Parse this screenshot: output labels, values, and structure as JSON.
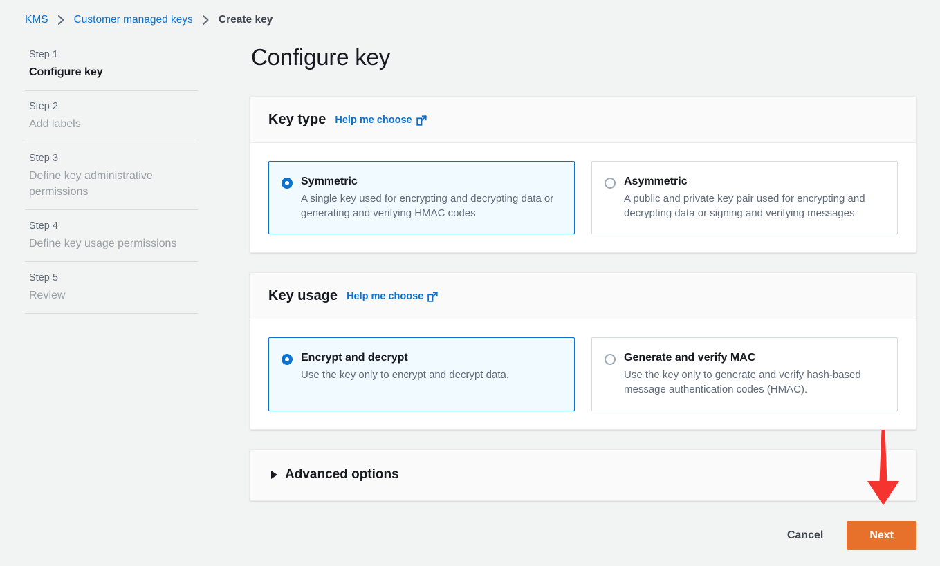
{
  "breadcrumb": {
    "items": [
      {
        "label": "KMS",
        "current": false
      },
      {
        "label": "Customer managed keys",
        "current": false
      },
      {
        "label": "Create key",
        "current": true
      }
    ]
  },
  "sidebar": {
    "steps": [
      {
        "number": "Step 1",
        "label": "Configure key",
        "active": true
      },
      {
        "number": "Step 2",
        "label": "Add labels",
        "active": false
      },
      {
        "number": "Step 3",
        "label": "Define key administrative permissions",
        "active": false
      },
      {
        "number": "Step 4",
        "label": "Define key usage permissions",
        "active": false
      },
      {
        "number": "Step 5",
        "label": "Review",
        "active": false
      }
    ]
  },
  "main": {
    "page_title": "Configure key",
    "key_type_panel": {
      "title": "Key type",
      "help_label": "Help me choose",
      "help_icon": "external-link-icon",
      "options": [
        {
          "title": "Symmetric",
          "description": "A single key used for encrypting and decrypting data or generating and verifying HMAC codes",
          "selected": true
        },
        {
          "title": "Asymmetric",
          "description": "A public and private key pair used for encrypting and decrypting data or signing and verifying messages",
          "selected": false
        }
      ]
    },
    "key_usage_panel": {
      "title": "Key usage",
      "help_label": "Help me choose",
      "help_icon": "external-link-icon",
      "options": [
        {
          "title": "Encrypt and decrypt",
          "description": "Use the key only to encrypt and decrypt data.",
          "selected": true
        },
        {
          "title": "Generate and verify MAC",
          "description": "Use the key only to generate and verify hash-based message authentication codes (HMAC).",
          "selected": false
        }
      ]
    },
    "advanced_options": {
      "label": "Advanced options",
      "expanded": false,
      "caret_icon": "caret-right-icon"
    },
    "actions": {
      "cancel_label": "Cancel",
      "next_label": "Next"
    }
  },
  "annotation": {
    "arrow": "red-down-arrow",
    "points_to": "Next"
  },
  "colors": {
    "page_background": "#f2f3f3",
    "link_blue": "#0972d3",
    "selected_card_background": "#f1faff",
    "primary_button": "#e7702a",
    "annotation_red": "#f6342f",
    "text_primary": "#16191f",
    "text_secondary": "#5f6b7a"
  }
}
